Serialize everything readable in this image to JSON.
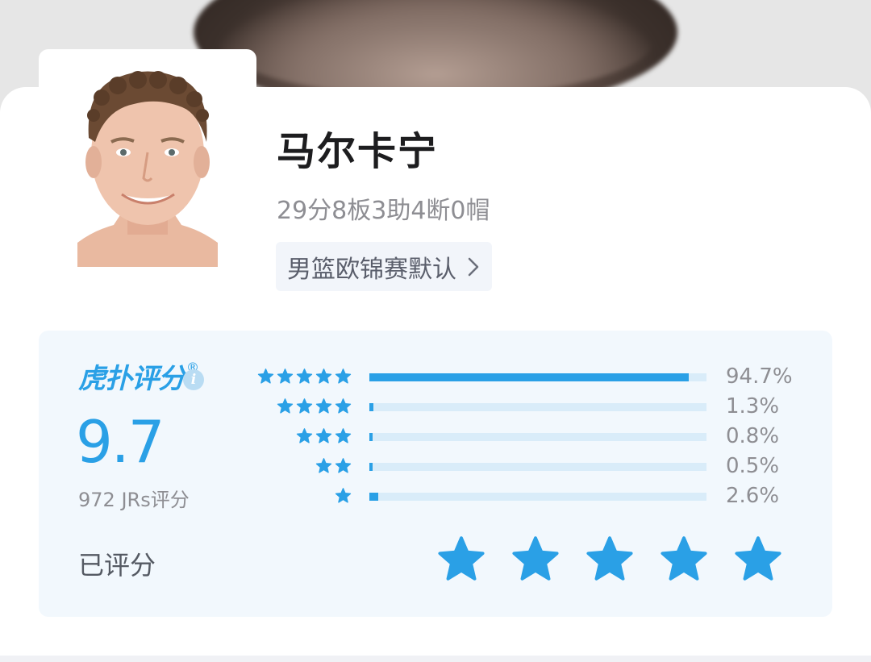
{
  "player": {
    "name": "马尔卡宁",
    "stats_line": "29分8板3助4断0帽",
    "league_tag": "男篮欧锦赛默认"
  },
  "rating": {
    "brand": "虎扑评分",
    "brand_mark": "®",
    "brand_sub": "JR",
    "info_glyph": "i",
    "score": "9.7",
    "count_text": "972 JRs评分",
    "rated_label": "已评分",
    "distribution": [
      {
        "stars": 5,
        "percent": 94.7,
        "label": "94.7%"
      },
      {
        "stars": 4,
        "percent": 1.3,
        "label": "1.3%"
      },
      {
        "stars": 3,
        "percent": 0.8,
        "label": "0.8%"
      },
      {
        "stars": 2,
        "percent": 0.5,
        "label": "0.5%"
      },
      {
        "stars": 1,
        "percent": 2.6,
        "label": "2.6%"
      }
    ],
    "user_rating_stars": 5
  },
  "icons": {
    "avatar": "player-headshot",
    "chevron": "chevron-right-icon",
    "info": "info-icon",
    "star": "star-icon"
  },
  "colors": {
    "accent": "#2aa0e6",
    "bar_track": "#d9ecf9",
    "panel_bg": "#f2f8fd"
  }
}
